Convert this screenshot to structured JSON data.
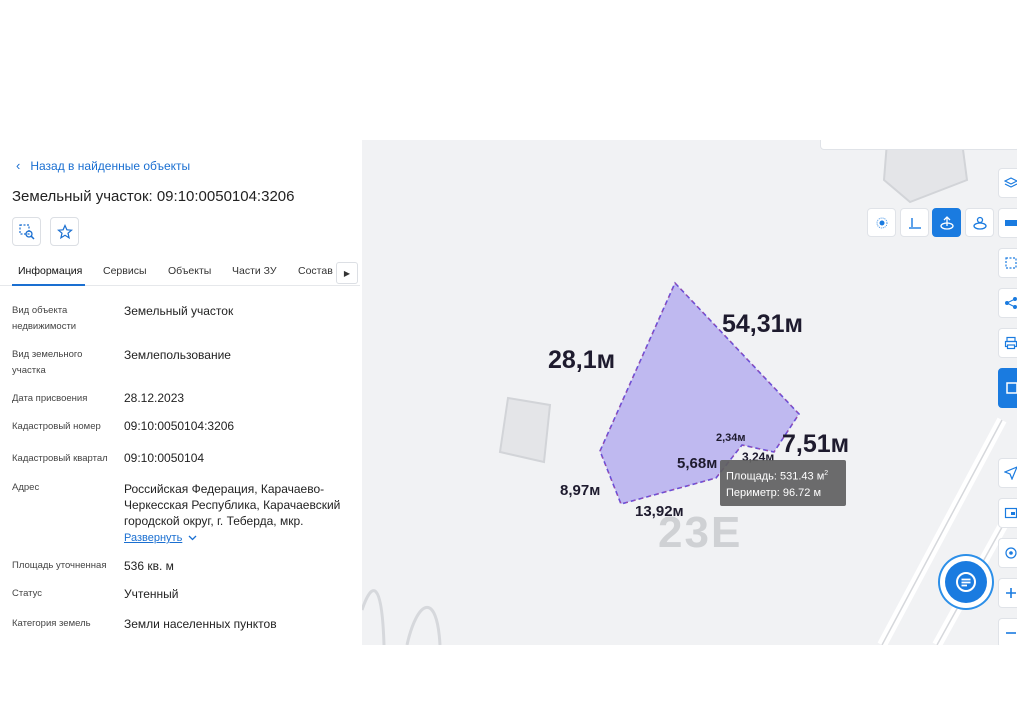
{
  "panel": {
    "back_label": "Назад в найденные объекты",
    "title": "Земельный участок: 09:10:0050104:3206",
    "tabs": [
      {
        "label": "Информация"
      },
      {
        "label": "Сервисы"
      },
      {
        "label": "Объекты"
      },
      {
        "label": "Части ЗУ"
      },
      {
        "label": "Состав"
      }
    ],
    "fields": [
      {
        "label": "Вид объекта недвижимости",
        "value": "Земельный участок"
      },
      {
        "label": "Вид земельного участка",
        "value": "Землепользование"
      },
      {
        "label": "Дата присвоения",
        "value": "28.12.2023"
      },
      {
        "label": "Кадастровый номер",
        "value": "09:10:0050104:3206"
      },
      {
        "label": "Кадастровый квартал",
        "value": "09:10:0050104"
      },
      {
        "label": "Адрес",
        "value": "Российская Федерация, Карачаево-Черкесская Республика, Карачаевский городской округ, г. Теберда, мкр."
      },
      {
        "label": "Площадь уточненная",
        "value": "536 кв. м"
      },
      {
        "label": "Статус",
        "value": "Учтенный"
      },
      {
        "label": "Категория земель",
        "value": "Земли населенных пунктов"
      }
    ],
    "expand_label": "Развернуть"
  },
  "map": {
    "house_number": "23E",
    "dimensions": {
      "d1": "28,1м",
      "d2": "54,31м",
      "d3": "7,51м",
      "d4": "2,34м",
      "d5": "3,24м",
      "d6": "5,68м",
      "d7": "8,97м",
      "d8": "13,92м"
    },
    "tooltip": {
      "area_label": "Площадь: 531.43 м",
      "area_sup": "2",
      "perimeter_label": "Периметр: 96.72 м"
    }
  },
  "colors": {
    "accent": "#1a7be0",
    "parcel_fill": "#b9b3f0",
    "parcel_stroke": "#6b4fd8"
  },
  "icons": {
    "locate": "target-icon",
    "favorite": "star-icon",
    "layers": "layers-icon",
    "ruler": "ruler-icon",
    "share": "share-icon",
    "print": "print-icon",
    "navigate": "navigation-arrow-icon",
    "zoom_in": "plus-icon",
    "chat": "chat-icon"
  }
}
